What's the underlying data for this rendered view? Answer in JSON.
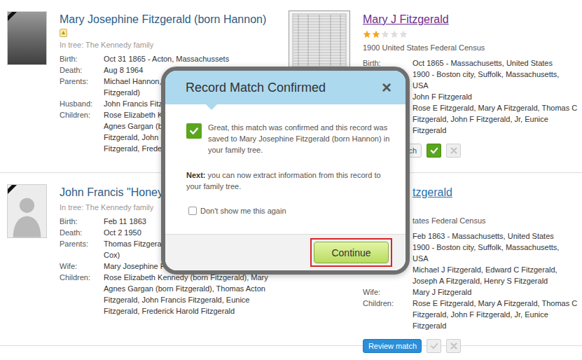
{
  "matches": [
    {
      "profile": {
        "name": "Mary Josephine Fitzgerald (born Hannon)",
        "kind": "photo",
        "hint_icon": true,
        "tree": "In tree: The Kennedy family",
        "fields": [
          {
            "label": "Birth:",
            "lines": [
              "Oct 31 1865 - Acton, Massachussets"
            ]
          },
          {
            "label": "Death:",
            "lines": [
              "Aug 8 1964"
            ]
          },
          {
            "label": "Parents:",
            "lines": [
              "Michael Hannon, M",
              "Fitzgerald)"
            ]
          },
          {
            "label": "Husband:",
            "lines": [
              "John Francis Fitz"
            ]
          },
          {
            "label": "Children:",
            "lines": [
              "Rose Elizabeth Ke",
              "Agnes Gargan (bor",
              "Fitzgerald, John F",
              "Fitzgerald, Freder"
            ]
          }
        ]
      },
      "record": {
        "title": "Mary J Fitzgerald",
        "visited": true,
        "stars": 2,
        "source": "1900 United States Federal Census",
        "fields": [
          {
            "label": "Birth:",
            "lines": [
              "Oct 1865 - Massachusetts, United States"
            ]
          },
          {
            "label": "",
            "lines": [
              "1900 - Boston city, Suffolk, Massachusetts,",
              "USA"
            ]
          },
          {
            "label": "",
            "lines": [
              "John F Fitzgerald"
            ]
          },
          {
            "label": "",
            "lines": [
              "Rose E Fitzgerald, Mary A Fitzgerald, Thomas C",
              "Fitzgerald, John F Fitzgerald, Jr, Eunice",
              "Fitzgerald"
            ]
          }
        ],
        "review_label": "ch",
        "confirmed": true
      }
    },
    {
      "profile": {
        "name": "John Francis \"Honey",
        "kind": "silhouette",
        "hint_icon": false,
        "tree": "In tree: The Kennedy family",
        "fields": [
          {
            "label": "Birth:",
            "lines": [
              "Feb 11 1863"
            ]
          },
          {
            "label": "Death:",
            "lines": [
              "Oct 2 1950"
            ]
          },
          {
            "label": "Parents:",
            "lines": [
              "Thomas Fitzgerald",
              "Cox)"
            ]
          },
          {
            "label": "Wife:",
            "lines": [
              "Mary Josephine F"
            ]
          },
          {
            "label": "Children:",
            "lines": [
              "Rose Elizabeth Kennedy (born Fitzgerald), Mary",
              "Agnes Gargan (born Fitzgerald), Thomas Acton",
              "Fitzgerald, John Francis Fitzgerald, Eunice",
              "Fitzgerald, Frederick Harold Fitzgerald"
            ]
          }
        ]
      },
      "record": {
        "title": "tzgerald",
        "visited": false,
        "source": "tates Federal Census",
        "fields": [
          {
            "label": "",
            "lines": [
              "Feb 1863 - Massachusetts, United States"
            ]
          },
          {
            "label": "",
            "lines": [
              "1900 - Boston city, Suffolk, Massachusetts,",
              "USA"
            ]
          },
          {
            "label": "",
            "lines": [
              "Michael J Fitzgerald, Edward C Fitzgerald,",
              "Joseph A Fitzgerald, Henry S Fitzgerald"
            ]
          },
          {
            "label": "Wife:",
            "lines": [
              "Mary J Fitzgerald"
            ]
          },
          {
            "label": "Children:",
            "lines": [
              "Rose E Fitzgerald, Mary A Fitzgerald, Thomas C",
              "Fitzgerald, John F Fitzgerald, Jr, Eunice",
              "Fitzgerald"
            ]
          }
        ],
        "review_label": "Review match",
        "confirmed": false
      }
    }
  ],
  "dialog": {
    "title": "Record Match Confirmed",
    "close": "×",
    "message": "Great, this match was confirmed and this record was saved to Mary Josephine Fitzgerald (born Hannon) in your family tree.",
    "next_label": "Next:",
    "next_text": "you can now extract information from this record to your family tree.",
    "dont_show": {
      "label": "Don't show me this again",
      "checked": false
    },
    "continue_label": "Continue",
    "continue_focused": true
  }
}
